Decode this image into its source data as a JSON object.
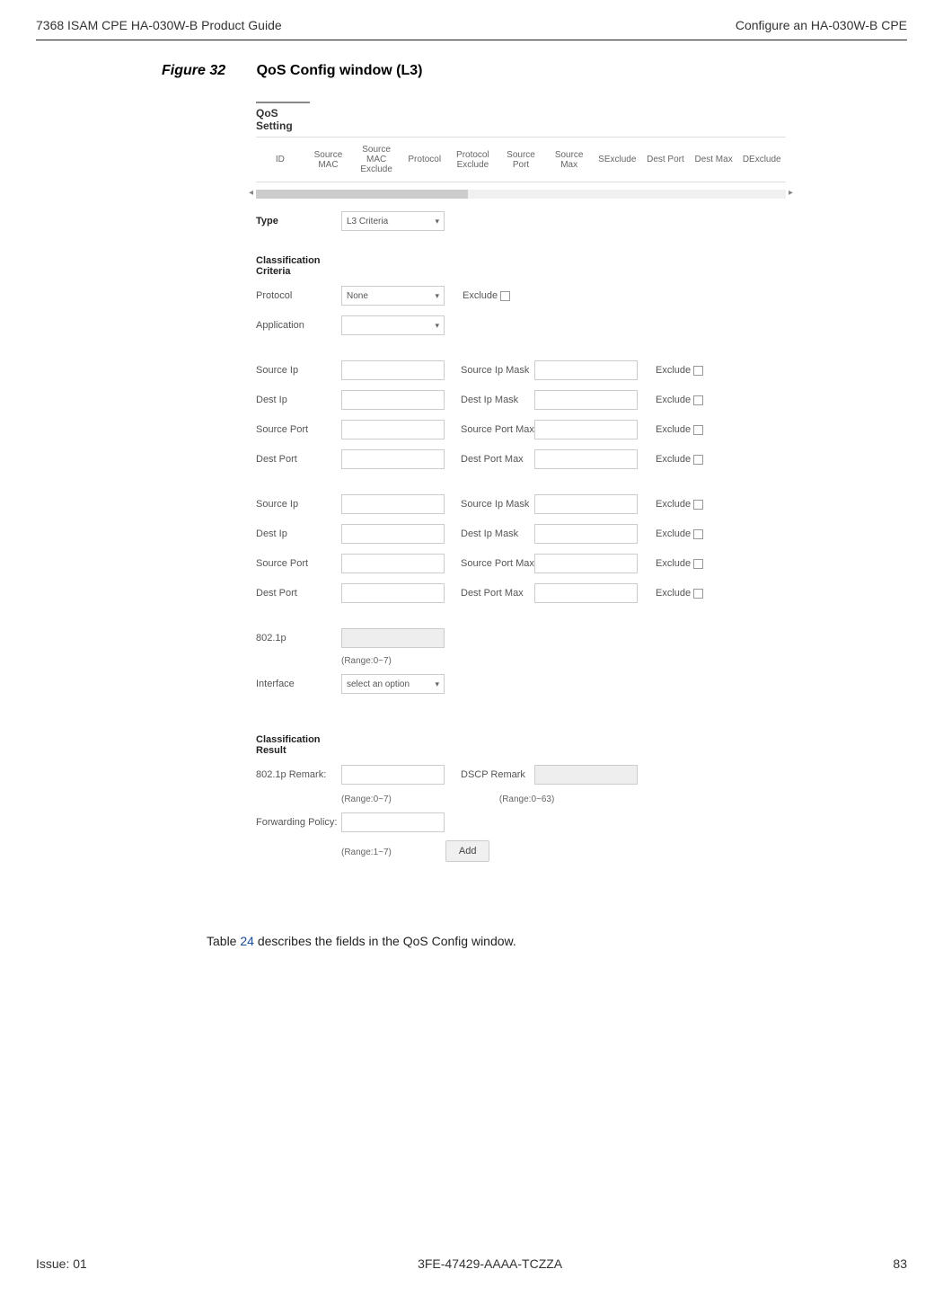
{
  "header": {
    "left": "7368 ISAM CPE HA-030W-B Product Guide",
    "right": "Configure an HA-030W-B CPE"
  },
  "figure": {
    "label": "Figure 32",
    "title": "QoS Config window (L3)"
  },
  "screenshot": {
    "qos_setting_heading": "QoS Setting",
    "table_columns": [
      "ID",
      "Source MAC",
      "Source MAC Exclude",
      "Protocol",
      "Protocol Exclude",
      "Source Port",
      "Source Max",
      "SExclude",
      "Dest Port",
      "Dest Max",
      "DExclude"
    ],
    "type_label": "Type",
    "type_value": "L3 Criteria",
    "classification_criteria": "Classification Criteria",
    "protocol_label": "Protocol",
    "protocol_value": "None",
    "exclude_text": "Exclude",
    "application_label": "Application",
    "source_ip": "Source Ip",
    "source_ip_mask": "Source Ip Mask",
    "dest_ip": "Dest Ip",
    "dest_ip_mask": "Dest Ip Mask",
    "source_port": "Source Port",
    "source_port_max": "Source Port Max",
    "dest_port": "Dest Port",
    "dest_port_max": "Dest Port Max",
    "p8021": "802.1p",
    "range07": "(Range:0~7)",
    "interface_label": "Interface",
    "interface_value": "select an option",
    "classification_result": "Classification Result",
    "p8021_remark": "802.1p Remark:",
    "dscp_remark": "DSCP Remark",
    "range063": "(Range:0~63)",
    "forwarding_policy": "Forwarding Policy:",
    "range17": "(Range:1~7)",
    "add_button": "Add"
  },
  "body_text": {
    "prefix": "Table ",
    "link_num": "24",
    "suffix": " describes the fields in the QoS Config window."
  },
  "footer": {
    "left": "Issue: 01",
    "center": "3FE-47429-AAAA-TCZZA",
    "right": "83"
  }
}
